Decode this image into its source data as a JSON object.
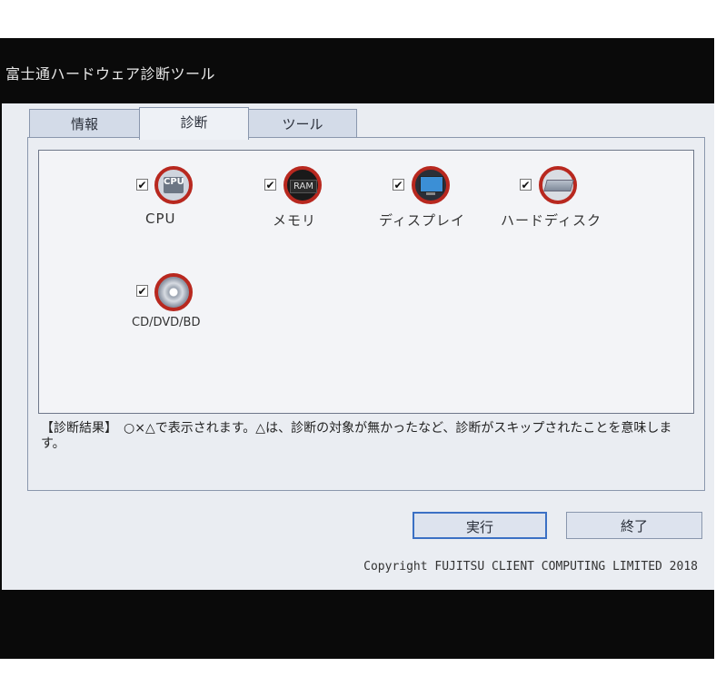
{
  "window": {
    "title": "富士通ハードウェア診断ツール"
  },
  "tabs": [
    {
      "label": "情報"
    },
    {
      "label": "診断"
    },
    {
      "label": "ツール"
    }
  ],
  "items": [
    {
      "label": "CPU",
      "checked": "✔",
      "icon": "cpu-icon",
      "icon_text": "CPU"
    },
    {
      "label": "メモリ",
      "checked": "✔",
      "icon": "ram-icon",
      "icon_text": "RAM"
    },
    {
      "label": "ディスプレイ",
      "checked": "✔",
      "icon": "display-icon"
    },
    {
      "label": "ハードディスク",
      "checked": "✔",
      "icon": "hard-disk-icon"
    },
    {
      "label": "CD/DVD/BD",
      "checked": "✔",
      "icon": "optical-disc-icon"
    }
  ],
  "result_text": "【診断結果】　○×△で表示されます。△は、診断の対象が無かったなど、診断がスキップされたことを意味します。",
  "buttons": {
    "run": "実行",
    "exit": "終了"
  },
  "copyright": "Copyright FUJITSU CLIENT COMPUTING LIMITED 2018",
  "colors": {
    "icon_ring": "#b8281f",
    "tab_bg": "#d3dbe8",
    "panel_bg": "#eaedf2"
  }
}
